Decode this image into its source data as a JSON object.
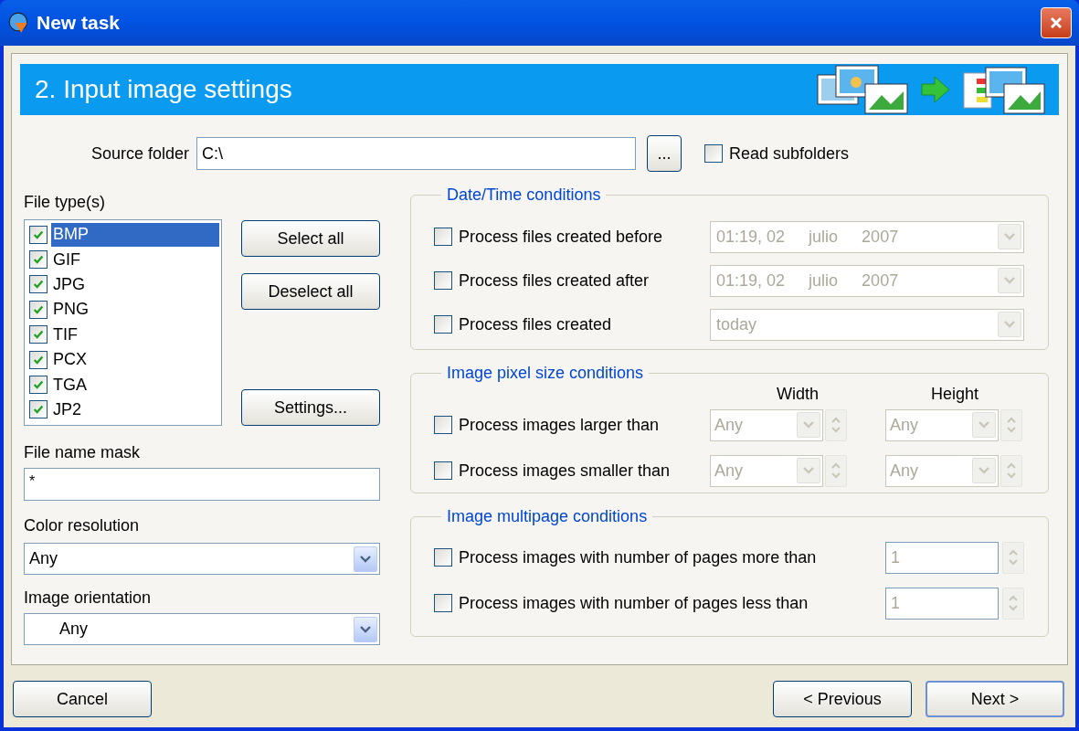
{
  "window": {
    "title": "New task"
  },
  "header": {
    "title": "2. Input image settings"
  },
  "source_folder": {
    "label": "Source folder",
    "value": "C:\\",
    "browse_button": "...",
    "read_subfolders": {
      "label": "Read subfolders",
      "checked": false
    }
  },
  "file_types": {
    "label": "File type(s)",
    "items": [
      {
        "label": "BMP",
        "checked": true,
        "selected": true
      },
      {
        "label": "GIF",
        "checked": true,
        "selected": false
      },
      {
        "label": "JPG",
        "checked": true,
        "selected": false
      },
      {
        "label": "PNG",
        "checked": true,
        "selected": false
      },
      {
        "label": "TIF",
        "checked": true,
        "selected": false
      },
      {
        "label": "PCX",
        "checked": true,
        "selected": false
      },
      {
        "label": "TGA",
        "checked": true,
        "selected": false
      },
      {
        "label": "JP2",
        "checked": true,
        "selected": false
      }
    ]
  },
  "file_type_buttons": {
    "select_all": "Select all",
    "deselect_all": "Deselect all",
    "settings": "Settings..."
  },
  "file_name_mask": {
    "label": "File name mask",
    "value": "*"
  },
  "color_resolution": {
    "label": "Color resolution",
    "value": "Any"
  },
  "image_orientation": {
    "label": "Image orientation",
    "value": "Any"
  },
  "date_time_conditions": {
    "title": "Date/Time conditions",
    "rows": [
      {
        "kind": "date",
        "label": "Process files created before",
        "checked": false,
        "time": "01:19, 02",
        "month": "julio",
        "year": "2007"
      },
      {
        "kind": "date",
        "label": "Process files created after",
        "checked": false,
        "time": "01:19, 02",
        "month": "julio",
        "year": "2007"
      },
      {
        "kind": "preset",
        "label": "Process files created",
        "checked": false,
        "value": "today"
      }
    ]
  },
  "pixel_size_conditions": {
    "title": "Image pixel size conditions",
    "columns": [
      "Width",
      "Height"
    ],
    "rows": [
      {
        "label": "Process images larger than",
        "checked": false,
        "width": "Any",
        "height": "Any"
      },
      {
        "label": "Process images smaller than",
        "checked": false,
        "width": "Any",
        "height": "Any"
      }
    ]
  },
  "multipage_conditions": {
    "title": "Image multipage conditions",
    "rows": [
      {
        "label": "Process images with number of pages more than",
        "checked": false,
        "value": "1"
      },
      {
        "label": "Process images with number of pages less than",
        "checked": false,
        "value": "1"
      }
    ]
  },
  "buttons": {
    "cancel": "Cancel",
    "previous": "< Previous",
    "next": "Next >"
  }
}
